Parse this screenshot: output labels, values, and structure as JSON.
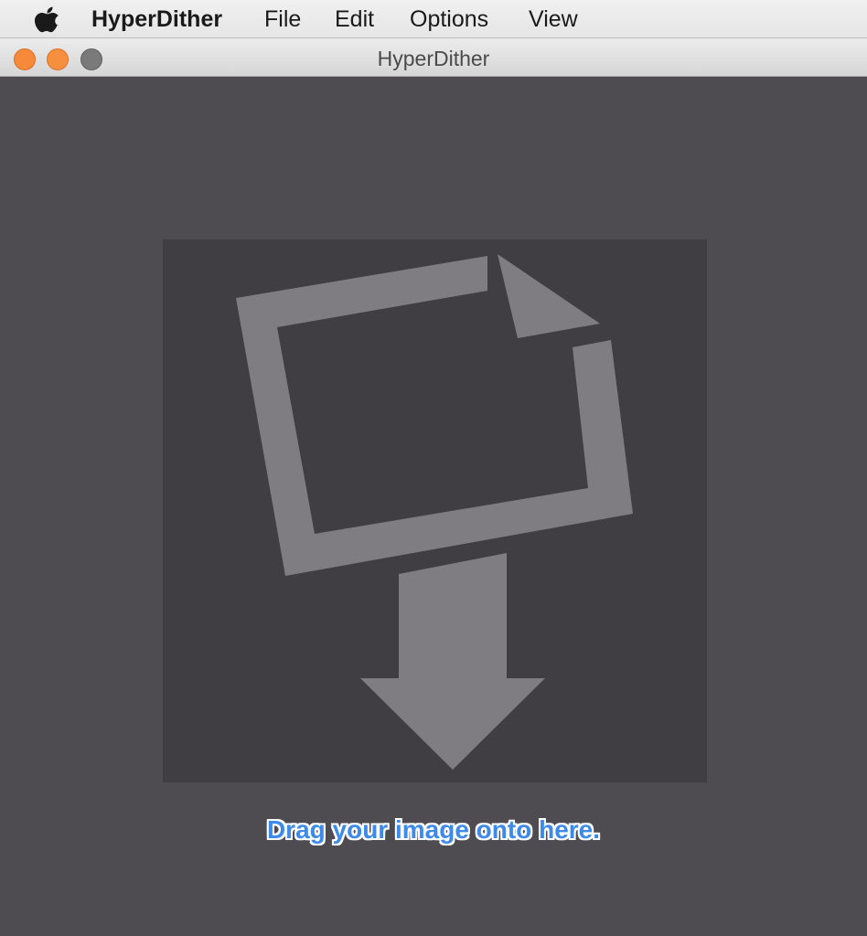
{
  "menubar": {
    "apple_icon": "apple-icon",
    "app_name": "HyperDither",
    "items": [
      "File",
      "Edit",
      "Options",
      "View"
    ]
  },
  "window": {
    "title": "HyperDither",
    "traffic_lights": {
      "close_color": "#f7893b",
      "minimize_color": "#f7903e",
      "zoom_color": "#7a7a7a"
    }
  },
  "drop_zone": {
    "icon": "image-drop-icon",
    "hint": "Drag your image onto here.",
    "hint_color": "#3d8ae8",
    "background_color": "#403e42",
    "icon_color": "#7f7d81"
  }
}
